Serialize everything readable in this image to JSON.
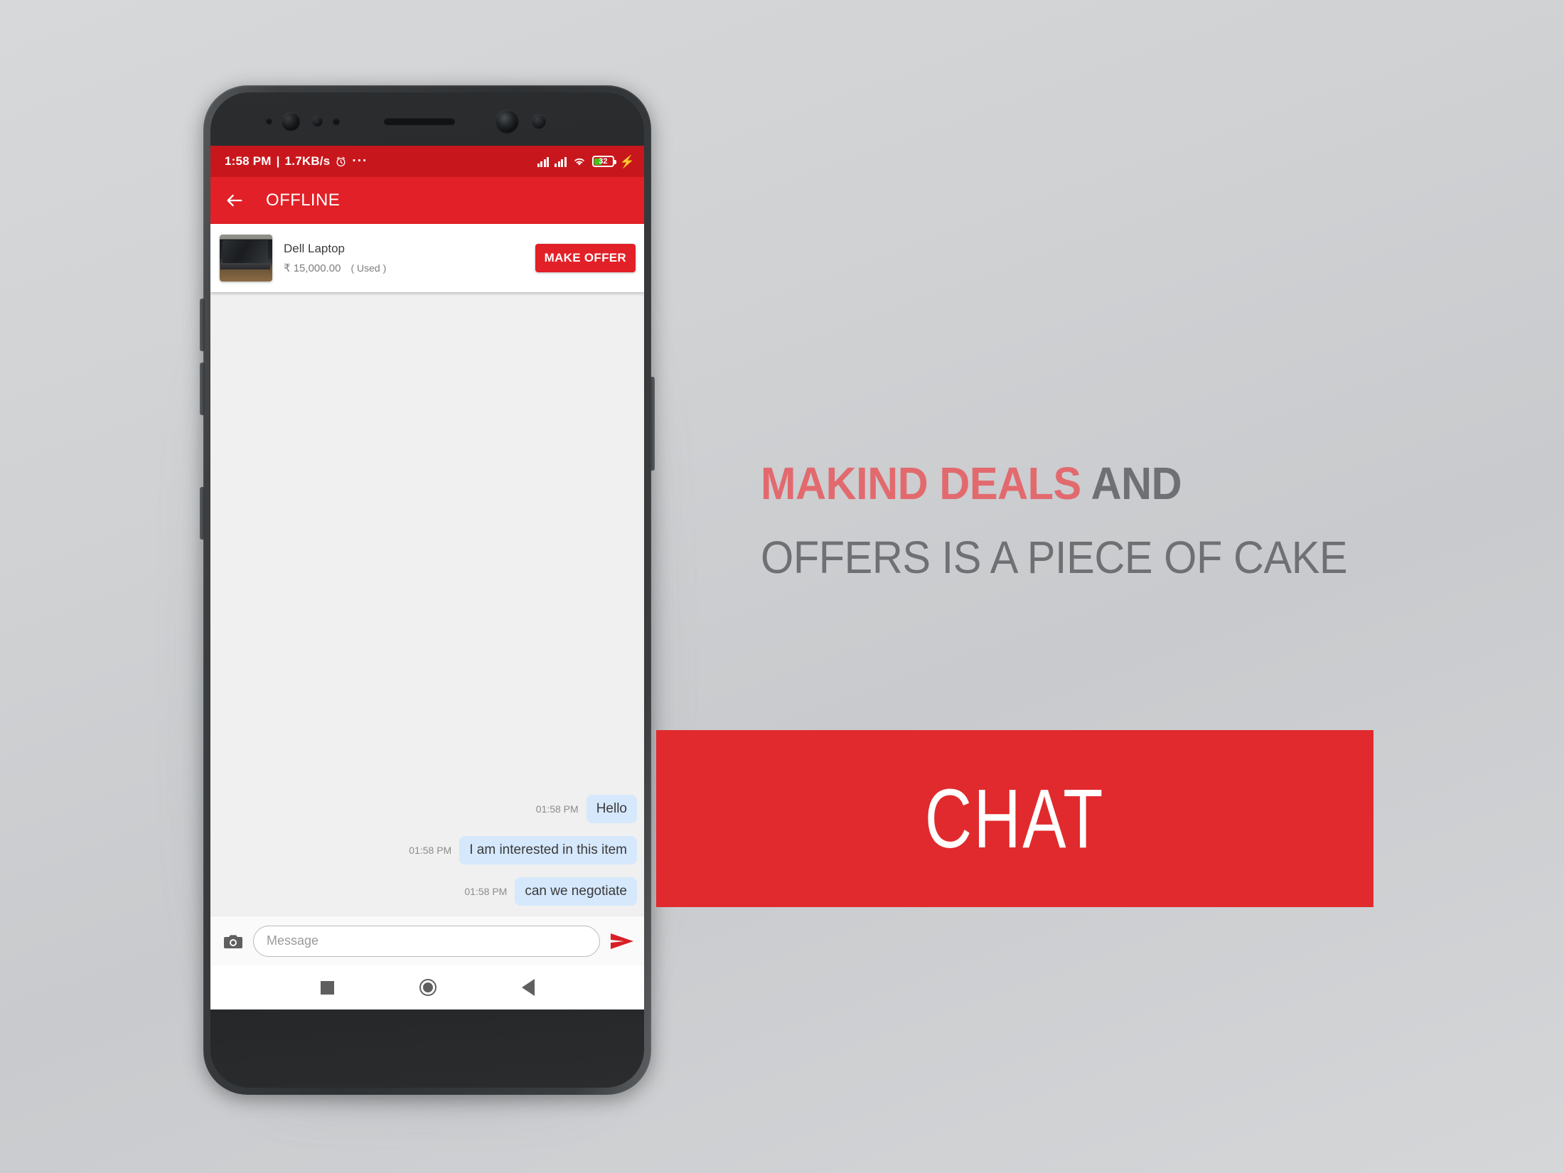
{
  "phone": {
    "status_bar": {
      "time": "1:58 PM",
      "separator": "|",
      "network_speed": "1.7KB/s",
      "alarm_icon": "alarm-clock-icon",
      "overflow_icon": "more-dots-icon",
      "signal_icon": "signal-bars-icon",
      "signal2_icon": "signal-bars-icon",
      "wifi_icon": "wifi-icon",
      "battery_level": "32",
      "battery_icon": "battery-icon",
      "charging_icon": "charging-bolt-icon",
      "background_color": "#c8171c"
    },
    "app_bar": {
      "back_icon": "back-arrow-icon",
      "title": "OFFLINE",
      "background_color": "#e22027"
    },
    "product": {
      "thumbnail_icon": "laptop-photo-thumbnail",
      "name": "Dell Laptop",
      "price": "₹ 15,000.00",
      "condition": "( Used )",
      "offer_button": "MAKE OFFER"
    },
    "chat": {
      "messages": [
        {
          "time": "01:58 PM",
          "text": "Hello"
        },
        {
          "time": "01:58 PM",
          "text": "I am interested in this item"
        },
        {
          "time": "01:58 PM",
          "text": "can we negotiate"
        }
      ],
      "bubble_color": "#d6e8fb",
      "background_color": "#f0f0f0"
    },
    "input_bar": {
      "camera_icon": "camera-icon",
      "message_value": "",
      "message_placeholder": "Message",
      "send_icon": "send-arrow-icon"
    },
    "nav_bar": {
      "recents_icon": "recents-square-icon",
      "home_icon": "home-circle-icon",
      "back_icon": "back-triangle-icon"
    }
  },
  "marketing": {
    "headline_accent": "MAKIND DEALS",
    "headline_rest": " AND",
    "headline_line2": "OFFERS IS A PIECE OF CAKE",
    "accent_color": "#e26a6e",
    "text_color": "#6e7073",
    "banner_label": "CHAT",
    "banner_color": "#e12a2d"
  }
}
